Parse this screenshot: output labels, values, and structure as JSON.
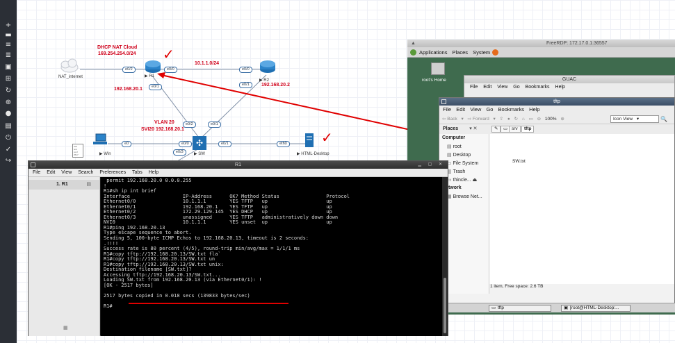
{
  "topology": {
    "dhcp_cloud_title": "DHCP NAT Cloud",
    "dhcp_cloud_subnet": "169.254.254.0/24",
    "nat_label": "NAT_internet",
    "link_r1_r2": "10.1.1.0/24",
    "r1_label": "R1",
    "r2_label": "R2",
    "r1_lan_ip": "192.168.20.1",
    "r2_lan_ip": "192.168.20.2",
    "vlan_title": "VLAN 20",
    "vlan_svi": "SVI20 192.168.20.1",
    "win_label": "Win",
    "sw_label": "SW",
    "desktop_label": "HTML-Desktop",
    "ports": {
      "nat_e02": "e0/2",
      "r1_e00": "e0/0",
      "r2_e00": "e0/0",
      "r1_e01": "e0/1",
      "r2_e01": "e0/1",
      "sw_e02": "e0/2",
      "sw_e01": "e0/1",
      "win_e0": "e0",
      "sw_e00": "e0/0",
      "sw_e03": "e0/3",
      "desk_eth0": "eth0"
    }
  },
  "r1_window": {
    "title": "R1",
    "menu": [
      "File",
      "Edit",
      "View",
      "Search",
      "Preferences",
      "Tabs",
      "Help"
    ],
    "tab_label": "1. R1",
    "terminal_lines": [
      " permit 192.168.20.0 0.0.0.255",
      "!",
      "R1#sh ip int brief",
      "Interface                  IP-Address      OK? Method Status                Protocol",
      "Ethernet0/0                10.1.1.1        YES TFTP   up                    up",
      "Ethernet0/1                192.168.20.1    YES TFTP   up                    up",
      "Ethernet0/2                172.29.129.145  YES DHCP   up                    up",
      "Ethernet0/3                unassigned      YES TFTP   administratively down down",
      "NVI0                       10.1.1.1        YES unset  up                    up",
      "R1#ping 192.168.20.13",
      "Type escape sequence to abort.",
      "Sending 5, 100-byte ICMP Echos to 192.168.20.13, timeout is 2 seconds:",
      ".!!!!",
      "Success rate is 80 percent (4/5), round-trip min/avg/max = 1/1/1 ms",
      "R1#copy tftp://192.168.20.13/SW.txt fla`",
      "R1#copy tftp://192.168.20.13/SW.txt un",
      "R1#copy tftp://192.168.20.13/SW.txt unix:",
      "Destination filename [SW.txt]?",
      "Accessing tftp://192.168.20.13/SW.txt...",
      "Loading SW.txt from 192.168.20.13 (via Ethernet0/1): !",
      "[OK - 2517 bytes]",
      "",
      "2517 bytes copied in 0.018 secs (139833 bytes/sec)",
      "",
      "R1#"
    ]
  },
  "rdp": {
    "title": "FreeRDP: 172.17.0.1:36557",
    "panel_menu": [
      "Applications",
      "Places",
      "System"
    ],
    "desktop_icon_label": "root's Home"
  },
  "guac_window": {
    "title": "GUAC",
    "menu": [
      "File",
      "Edit",
      "View",
      "Go",
      "Bookmarks",
      "Help"
    ]
  },
  "tftp_window": {
    "title": "tftp",
    "menu": [
      "File",
      "Edit",
      "View",
      "Go",
      "Bookmarks",
      "Help"
    ],
    "toolbar": {
      "back": "Back",
      "forward": "Forward",
      "zoom": "100%",
      "view_mode": "Icon View"
    },
    "places_header": "Places",
    "breadcrumbs": [
      "srv",
      "tftp"
    ],
    "sidebar": {
      "computer_header": "Computer",
      "computer_items": [
        "root",
        "Desktop",
        "File System",
        "Trash",
        "thincle..."
      ],
      "network_header": "Network",
      "network_items": [
        "Browse Net..."
      ]
    },
    "file_name": "SW.txt",
    "status": "1 item, Free space: 2.6 TB"
  },
  "taskbar": {
    "items": [
      "tftp",
      "[root@HTML-Desktop:..."
    ]
  },
  "annotation_color": "#e00000"
}
